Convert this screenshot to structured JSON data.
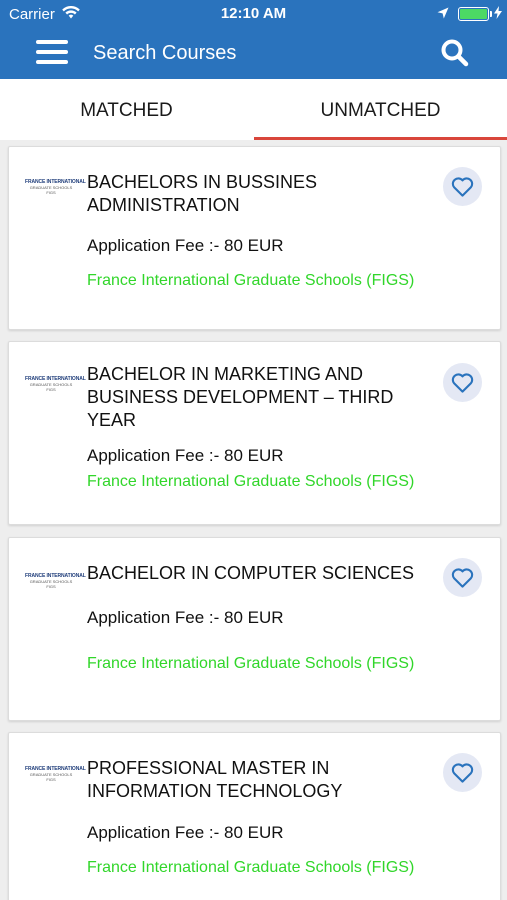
{
  "status_bar": {
    "carrier": "Carrier",
    "time": "12:10 AM"
  },
  "header": {
    "title": "Search Courses"
  },
  "tabs": [
    {
      "label": "MATCHED",
      "active": false
    },
    {
      "label": "UNMATCHED",
      "active": true
    }
  ],
  "colors": {
    "header": "#2a73bd",
    "active_tab": "#d9463b",
    "school": "#31d62a",
    "fav_bg": "#e4e8f4"
  },
  "courses": [
    {
      "logo": {
        "line1": "FRANCE INTERNATIONAL",
        "line2": "GRADUATE SCHOOLS",
        "line3": "FIGS"
      },
      "title": "BACHELORS IN BUSSINES ADMINISTRATION",
      "fee": "Application Fee :- 80 EUR",
      "school": "France International Graduate Schools (FIGS)"
    },
    {
      "logo": {
        "line1": "FRANCE INTERNATIONAL",
        "line2": "GRADUATE SCHOOLS",
        "line3": "FIGS"
      },
      "title": "BACHELOR IN MARKETING AND BUSINESS DEVELOPMENT – THIRD YEAR",
      "fee": "Application Fee :- 80 EUR",
      "school": "France International Graduate Schools (FIGS)"
    },
    {
      "logo": {
        "line1": "FRANCE INTERNATIONAL",
        "line2": "GRADUATE SCHOOLS",
        "line3": "FIGS"
      },
      "title": "BACHELOR IN COMPUTER SCIENCES",
      "fee": "Application Fee :- 80 EUR",
      "school": "France International Graduate Schools (FIGS)"
    },
    {
      "logo": {
        "line1": "FRANCE INTERNATIONAL",
        "line2": "GRADUATE SCHOOLS",
        "line3": "FIGS"
      },
      "title": "PROFESSIONAL MASTER IN INFORMATION TECHNOLOGY",
      "fee": "Application Fee :- 80 EUR",
      "school": "France International Graduate Schools (FIGS)"
    }
  ]
}
